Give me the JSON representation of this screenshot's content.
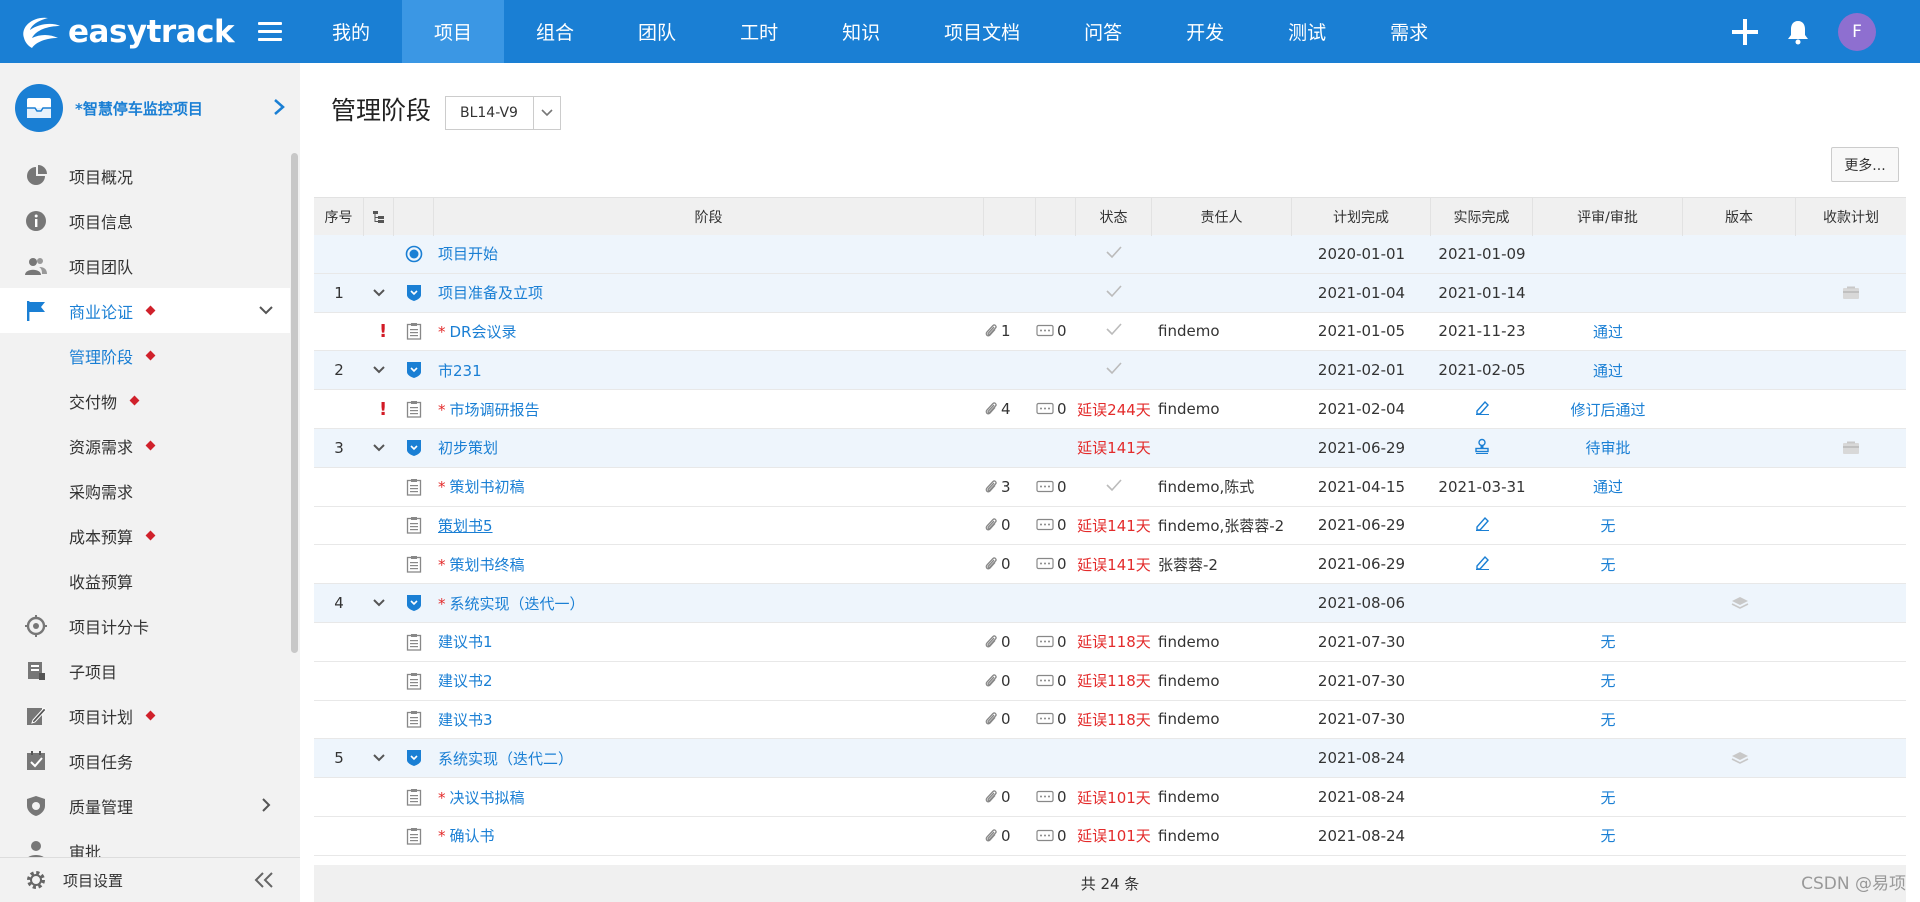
{
  "app": {
    "logo": "easytrack"
  },
  "nav": {
    "items": [
      "我的",
      "项目",
      "组合",
      "团队",
      "工时",
      "知识",
      "项目文档",
      "问答",
      "开发",
      "测试",
      "需求"
    ],
    "active_index": 1
  },
  "user": {
    "avatar_letter": "F"
  },
  "sidebar": {
    "project_name": "*智慧停车监控项目",
    "items": [
      {
        "label": "项目概况",
        "icon": "pie-chart-icon"
      },
      {
        "label": "项目信息",
        "icon": "info-icon"
      },
      {
        "label": "项目团队",
        "icon": "team-icon"
      },
      {
        "label": "商业论证",
        "icon": "flag-icon"
      },
      {
        "label": "项目计分卡",
        "icon": "target-icon"
      },
      {
        "label": "子项目",
        "icon": "subproject-icon"
      },
      {
        "label": "项目计划",
        "icon": "plan-icon"
      },
      {
        "label": "项目任务",
        "icon": "task-icon"
      },
      {
        "label": "质量管理",
        "icon": "shield-icon"
      },
      {
        "label": "审批",
        "icon": "user-icon"
      }
    ],
    "sub_items": [
      {
        "label": "管理阶段"
      },
      {
        "label": "交付物"
      },
      {
        "label": "资源需求"
      },
      {
        "label": "采购需求"
      },
      {
        "label": "成本预算"
      },
      {
        "label": "收益预算"
      }
    ],
    "footer": "项目设置"
  },
  "page": {
    "title": "管理阶段",
    "version": "BL14-V9",
    "more": "更多..."
  },
  "table": {
    "headers": {
      "no": "序号",
      "stage": "阶段",
      "status": "状态",
      "owner": "责任人",
      "plan": "计划完成",
      "actual": "实际完成",
      "review": "评审/审批",
      "version": "版本",
      "payment": "收款计划"
    },
    "rows": [
      {
        "no": "",
        "stage": "项目开始",
        "req": "",
        "att": "",
        "cmt": "",
        "status": "",
        "owner": "",
        "plan": "2020-01-01",
        "actual": "2021-01-09",
        "review": ""
      },
      {
        "no": "1",
        "stage": "项目准备及立项",
        "req": "",
        "att": "",
        "cmt": "",
        "status": "",
        "owner": "",
        "plan": "2021-01-04",
        "actual": "2021-01-14",
        "review": ""
      },
      {
        "no": "",
        "stage": "DR会议录",
        "req": "*",
        "att": "1",
        "cmt": "0",
        "status": "",
        "owner": "findemo",
        "plan": "2021-01-05",
        "actual": "2021-11-23",
        "review": "通过"
      },
      {
        "no": "2",
        "stage": "市231",
        "req": "",
        "att": "",
        "cmt": "",
        "status": "",
        "owner": "",
        "plan": "2021-02-01",
        "actual": "2021-02-05",
        "review": "通过"
      },
      {
        "no": "",
        "stage": "市场调研报告",
        "req": "*",
        "att": "4",
        "cmt": "0",
        "status": "延误244天",
        "owner": "findemo",
        "plan": "2021-02-04",
        "actual": "",
        "review": "修订后通过"
      },
      {
        "no": "3",
        "stage": "初步策划",
        "req": "",
        "att": "",
        "cmt": "",
        "status": "延误141天",
        "owner": "",
        "plan": "2021-06-29",
        "actual": "",
        "review": "待审批"
      },
      {
        "no": "",
        "stage": "策划书初稿",
        "req": "*",
        "att": "3",
        "cmt": "0",
        "status": "",
        "owner": "findemo,陈式",
        "plan": "2021-04-15",
        "actual": "2021-03-31",
        "review": "通过"
      },
      {
        "no": "",
        "stage": "策划书5",
        "req": "",
        "att": "0",
        "cmt": "0",
        "status": "延误141天",
        "owner": "findemo,张蓉蓉-2",
        "plan": "2021-06-29",
        "actual": "",
        "review": "无"
      },
      {
        "no": "",
        "stage": "策划书终稿",
        "req": "*",
        "att": "0",
        "cmt": "0",
        "status": "延误141天",
        "owner": "张蓉蓉-2",
        "plan": "2021-06-29",
        "actual": "",
        "review": "无"
      },
      {
        "no": "4",
        "stage": "系统实现（迭代一）",
        "req": "*",
        "att": "",
        "cmt": "",
        "status": "",
        "owner": "",
        "plan": "2021-08-06",
        "actual": "",
        "review": ""
      },
      {
        "no": "",
        "stage": "建议书1",
        "req": "",
        "att": "0",
        "cmt": "0",
        "status": "延误118天",
        "owner": "findemo",
        "plan": "2021-07-30",
        "actual": "",
        "review": "无"
      },
      {
        "no": "",
        "stage": "建议书2",
        "req": "",
        "att": "0",
        "cmt": "0",
        "status": "延误118天",
        "owner": "findemo",
        "plan": "2021-07-30",
        "actual": "",
        "review": "无"
      },
      {
        "no": "",
        "stage": "建议书3",
        "req": "",
        "att": "0",
        "cmt": "0",
        "status": "延误118天",
        "owner": "findemo",
        "plan": "2021-07-30",
        "actual": "",
        "review": "无"
      },
      {
        "no": "5",
        "stage": "系统实现（迭代二）",
        "req": "",
        "att": "",
        "cmt": "",
        "status": "",
        "owner": "",
        "plan": "2021-08-24",
        "actual": "",
        "review": ""
      },
      {
        "no": "",
        "stage": "决议书拟稿",
        "req": "*",
        "att": "0",
        "cmt": "0",
        "status": "延误101天",
        "owner": "findemo",
        "plan": "2021-08-24",
        "actual": "",
        "review": "无"
      },
      {
        "no": "",
        "stage": "确认书",
        "req": "*",
        "att": "0",
        "cmt": "0",
        "status": "延误101天",
        "owner": "findemo",
        "plan": "2021-08-24",
        "actual": "",
        "review": "无"
      }
    ],
    "footer": "共 24 条"
  },
  "watermark": "CSDN @易项"
}
